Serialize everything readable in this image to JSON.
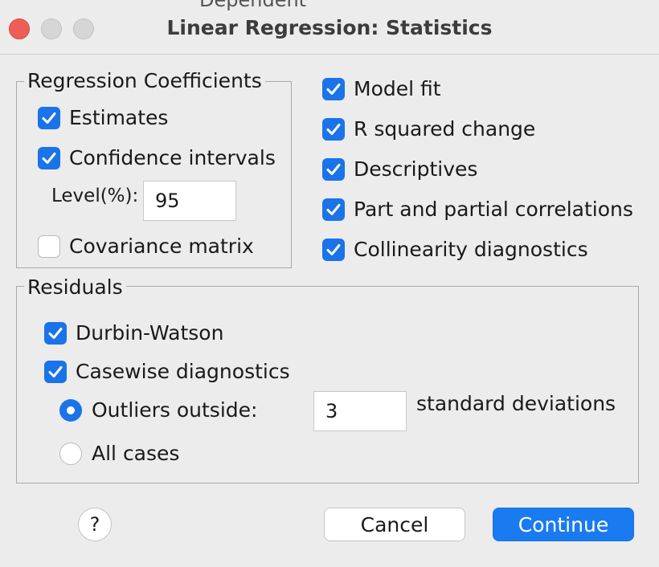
{
  "window": {
    "title": "Linear Regression: Statistics",
    "behind_text": "Dependent"
  },
  "regression_coefficients": {
    "legend": "Regression Coefficients",
    "estimates": {
      "label": "Estimates",
      "checked": true
    },
    "confidence_intervals": {
      "label": "Confidence intervals",
      "checked": true
    },
    "level_label": "Level(%):",
    "level_value": "95",
    "covariance_matrix": {
      "label": "Covariance matrix",
      "checked": false
    }
  },
  "options": {
    "model_fit": {
      "label": "Model fit",
      "checked": true
    },
    "r_squared_change": {
      "label": "R squared change",
      "checked": true
    },
    "descriptives": {
      "label": "Descriptives",
      "checked": true
    },
    "part_partial": {
      "label": "Part and partial correlations",
      "checked": true
    },
    "collinearity": {
      "label": "Collinearity diagnostics",
      "checked": true
    }
  },
  "residuals": {
    "legend": "Residuals",
    "durbin_watson": {
      "label": "Durbin-Watson",
      "checked": true
    },
    "casewise": {
      "label": "Casewise diagnostics",
      "checked": true
    },
    "outliers_outside": {
      "label": "Outliers outside:",
      "selected": true
    },
    "outliers_value": "3",
    "std_dev_label": "standard deviations",
    "all_cases": {
      "label": "All cases",
      "selected": false
    }
  },
  "buttons": {
    "help": "?",
    "cancel": "Cancel",
    "continue": "Continue"
  },
  "colors": {
    "accent": "#1a73e8",
    "close_button": "#ee5e57"
  }
}
